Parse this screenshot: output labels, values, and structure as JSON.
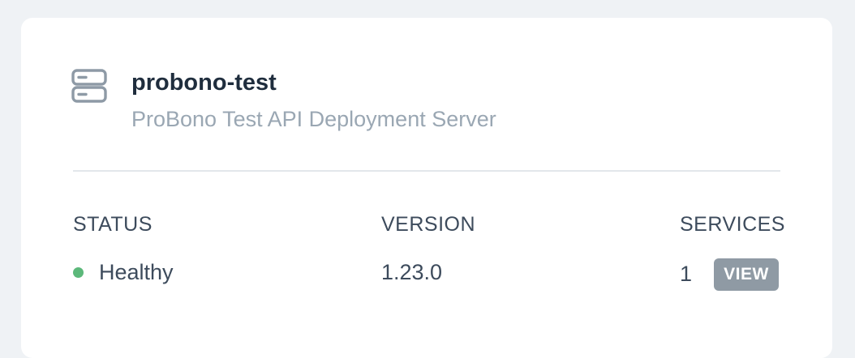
{
  "server": {
    "name": "probono-test",
    "description": "ProBono Test API Deployment Server",
    "icon": "server-icon"
  },
  "columns": {
    "status": {
      "label": "STATUS",
      "value": "Healthy",
      "indicator_color": "#5cb87a"
    },
    "version": {
      "label": "VERSION",
      "value": "1.23.0"
    },
    "services": {
      "label": "SERVICES",
      "count": "1",
      "button_label": "VIEW"
    }
  }
}
